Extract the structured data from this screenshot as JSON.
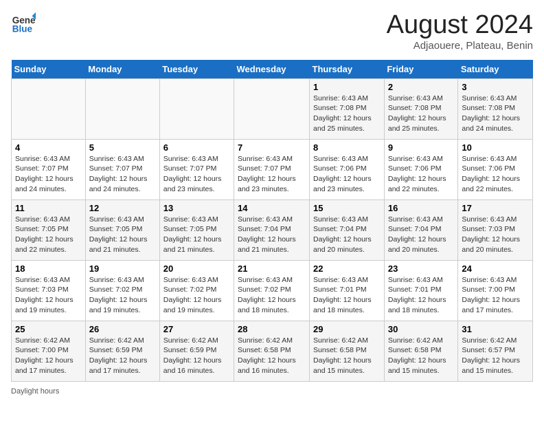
{
  "header": {
    "logo_line1": "General",
    "logo_line2": "Blue",
    "main_title": "August 2024",
    "subtitle": "Adjaouere, Plateau, Benin"
  },
  "days_of_week": [
    "Sunday",
    "Monday",
    "Tuesday",
    "Wednesday",
    "Thursday",
    "Friday",
    "Saturday"
  ],
  "weeks": [
    [
      {
        "day": "",
        "info": ""
      },
      {
        "day": "",
        "info": ""
      },
      {
        "day": "",
        "info": ""
      },
      {
        "day": "",
        "info": ""
      },
      {
        "day": "1",
        "info": "Sunrise: 6:43 AM\nSunset: 7:08 PM\nDaylight: 12 hours and 25 minutes."
      },
      {
        "day": "2",
        "info": "Sunrise: 6:43 AM\nSunset: 7:08 PM\nDaylight: 12 hours and 25 minutes."
      },
      {
        "day": "3",
        "info": "Sunrise: 6:43 AM\nSunset: 7:08 PM\nDaylight: 12 hours and 24 minutes."
      }
    ],
    [
      {
        "day": "4",
        "info": "Sunrise: 6:43 AM\nSunset: 7:07 PM\nDaylight: 12 hours and 24 minutes."
      },
      {
        "day": "5",
        "info": "Sunrise: 6:43 AM\nSunset: 7:07 PM\nDaylight: 12 hours and 24 minutes."
      },
      {
        "day": "6",
        "info": "Sunrise: 6:43 AM\nSunset: 7:07 PM\nDaylight: 12 hours and 23 minutes."
      },
      {
        "day": "7",
        "info": "Sunrise: 6:43 AM\nSunset: 7:07 PM\nDaylight: 12 hours and 23 minutes."
      },
      {
        "day": "8",
        "info": "Sunrise: 6:43 AM\nSunset: 7:06 PM\nDaylight: 12 hours and 23 minutes."
      },
      {
        "day": "9",
        "info": "Sunrise: 6:43 AM\nSunset: 7:06 PM\nDaylight: 12 hours and 22 minutes."
      },
      {
        "day": "10",
        "info": "Sunrise: 6:43 AM\nSunset: 7:06 PM\nDaylight: 12 hours and 22 minutes."
      }
    ],
    [
      {
        "day": "11",
        "info": "Sunrise: 6:43 AM\nSunset: 7:05 PM\nDaylight: 12 hours and 22 minutes."
      },
      {
        "day": "12",
        "info": "Sunrise: 6:43 AM\nSunset: 7:05 PM\nDaylight: 12 hours and 21 minutes."
      },
      {
        "day": "13",
        "info": "Sunrise: 6:43 AM\nSunset: 7:05 PM\nDaylight: 12 hours and 21 minutes."
      },
      {
        "day": "14",
        "info": "Sunrise: 6:43 AM\nSunset: 7:04 PM\nDaylight: 12 hours and 21 minutes."
      },
      {
        "day": "15",
        "info": "Sunrise: 6:43 AM\nSunset: 7:04 PM\nDaylight: 12 hours and 20 minutes."
      },
      {
        "day": "16",
        "info": "Sunrise: 6:43 AM\nSunset: 7:04 PM\nDaylight: 12 hours and 20 minutes."
      },
      {
        "day": "17",
        "info": "Sunrise: 6:43 AM\nSunset: 7:03 PM\nDaylight: 12 hours and 20 minutes."
      }
    ],
    [
      {
        "day": "18",
        "info": "Sunrise: 6:43 AM\nSunset: 7:03 PM\nDaylight: 12 hours and 19 minutes."
      },
      {
        "day": "19",
        "info": "Sunrise: 6:43 AM\nSunset: 7:02 PM\nDaylight: 12 hours and 19 minutes."
      },
      {
        "day": "20",
        "info": "Sunrise: 6:43 AM\nSunset: 7:02 PM\nDaylight: 12 hours and 19 minutes."
      },
      {
        "day": "21",
        "info": "Sunrise: 6:43 AM\nSunset: 7:02 PM\nDaylight: 12 hours and 18 minutes."
      },
      {
        "day": "22",
        "info": "Sunrise: 6:43 AM\nSunset: 7:01 PM\nDaylight: 12 hours and 18 minutes."
      },
      {
        "day": "23",
        "info": "Sunrise: 6:43 AM\nSunset: 7:01 PM\nDaylight: 12 hours and 18 minutes."
      },
      {
        "day": "24",
        "info": "Sunrise: 6:43 AM\nSunset: 7:00 PM\nDaylight: 12 hours and 17 minutes."
      }
    ],
    [
      {
        "day": "25",
        "info": "Sunrise: 6:42 AM\nSunset: 7:00 PM\nDaylight: 12 hours and 17 minutes."
      },
      {
        "day": "26",
        "info": "Sunrise: 6:42 AM\nSunset: 6:59 PM\nDaylight: 12 hours and 17 minutes."
      },
      {
        "day": "27",
        "info": "Sunrise: 6:42 AM\nSunset: 6:59 PM\nDaylight: 12 hours and 16 minutes."
      },
      {
        "day": "28",
        "info": "Sunrise: 6:42 AM\nSunset: 6:58 PM\nDaylight: 12 hours and 16 minutes."
      },
      {
        "day": "29",
        "info": "Sunrise: 6:42 AM\nSunset: 6:58 PM\nDaylight: 12 hours and 15 minutes."
      },
      {
        "day": "30",
        "info": "Sunrise: 6:42 AM\nSunset: 6:58 PM\nDaylight: 12 hours and 15 minutes."
      },
      {
        "day": "31",
        "info": "Sunrise: 6:42 AM\nSunset: 6:57 PM\nDaylight: 12 hours and 15 minutes."
      }
    ]
  ],
  "footer": {
    "daylight_label": "Daylight hours"
  }
}
